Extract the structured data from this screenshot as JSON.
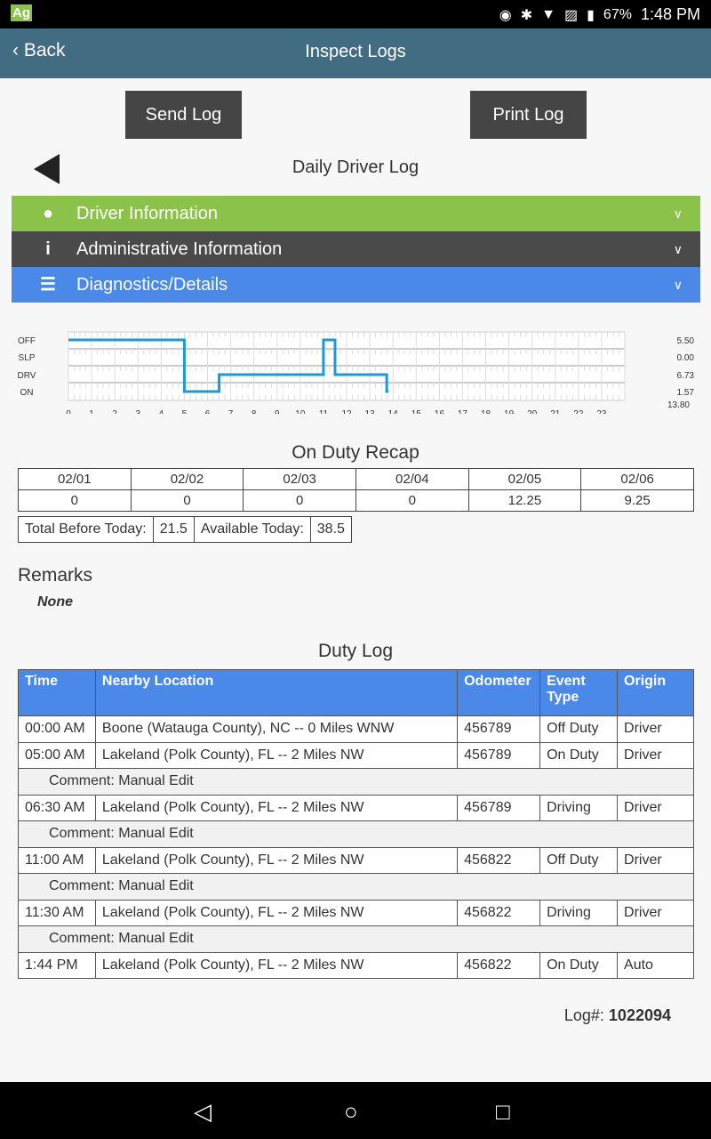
{
  "status_bar": {
    "app_icon": "Ag",
    "battery": "67%",
    "time": "1:48 PM",
    "icons": [
      "location-icon",
      "bluetooth-icon",
      "wifi-icon",
      "no-sim-icon",
      "battery-icon"
    ]
  },
  "nav": {
    "back": "Back",
    "title": "Inspect Logs"
  },
  "actions": {
    "send": "Send Log",
    "print": "Print Log"
  },
  "log_title": "Daily Driver Log",
  "sections": [
    {
      "label": "Driver Information",
      "icon": "user-icon",
      "color": "#8bc34a"
    },
    {
      "label": "Administrative Information",
      "icon": "info-icon",
      "color": "#4a4a4a"
    },
    {
      "label": "Diagnostics/Details",
      "icon": "list-icon",
      "color": "#4a89e8"
    }
  ],
  "chart_data": {
    "type": "line",
    "statuses": [
      "OFF",
      "SLP",
      "DRV",
      "ON"
    ],
    "x_ticks": [
      "0",
      "1",
      "2",
      "3",
      "4",
      "5",
      "6",
      "7",
      "8",
      "9",
      "10",
      "11",
      "12",
      "13",
      "14",
      "15",
      "16",
      "17",
      "18",
      "19",
      "20",
      "21",
      "22",
      "23"
    ],
    "xlim": [
      0,
      24
    ],
    "steps": [
      [
        0,
        "OFF"
      ],
      [
        5,
        "ON"
      ],
      [
        6.5,
        "DRV"
      ],
      [
        11,
        "OFF"
      ],
      [
        11.5,
        "DRV"
      ],
      [
        13.73,
        "ON"
      ],
      [
        13.8,
        "ON"
      ]
    ],
    "totals": [
      "5.50",
      "0.00",
      "6.73",
      "1.57"
    ],
    "grand_total": "13.80",
    "line_color": "#1a9ad6"
  },
  "recap": {
    "title": "On Duty Recap",
    "dates": [
      "02/01",
      "02/02",
      "02/03",
      "02/04",
      "02/05",
      "02/06"
    ],
    "values": [
      "0",
      "0",
      "0",
      "0",
      "12.25",
      "9.25"
    ],
    "total_before_label": "Total Before Today:",
    "total_before": "21.5",
    "available_label": "Available Today:",
    "available": "38.5"
  },
  "remarks": {
    "title": "Remarks",
    "value": "None"
  },
  "duty_log": {
    "title": "Duty Log",
    "headers": [
      "Time",
      "Nearby Location",
      "Odometer",
      "Event Type",
      "Origin"
    ],
    "rows": [
      {
        "time": "00:00 AM",
        "loc": "Boone (Watauga County), NC -- 0 Miles WNW",
        "odo": "456789",
        "event": "Off Duty",
        "origin": "Driver"
      },
      {
        "time": "05:00 AM",
        "loc": "Lakeland (Polk County), FL -- 2 Miles NW",
        "odo": "456789",
        "event": "On Duty",
        "origin": "Driver",
        "comment": "Comment: Manual Edit"
      },
      {
        "time": "06:30 AM",
        "loc": "Lakeland (Polk County), FL -- 2 Miles NW",
        "odo": "456789",
        "event": "Driving",
        "origin": "Driver",
        "comment": "Comment: Manual Edit"
      },
      {
        "time": "11:00 AM",
        "loc": "Lakeland (Polk County), FL -- 2 Miles NW",
        "odo": "456822",
        "event": "Off Duty",
        "origin": "Driver",
        "comment": "Comment: Manual Edit"
      },
      {
        "time": "11:30 AM",
        "loc": "Lakeland (Polk County), FL -- 2 Miles NW",
        "odo": "456822",
        "event": "Driving",
        "origin": "Driver",
        "comment": "Comment: Manual Edit"
      },
      {
        "time": "1:44 PM",
        "loc": "Lakeland (Polk County), FL -- 2 Miles NW",
        "odo": "456822",
        "event": "On Duty",
        "origin": "Auto"
      }
    ]
  },
  "log_number": {
    "label": "Log#:",
    "value": "1022094"
  }
}
